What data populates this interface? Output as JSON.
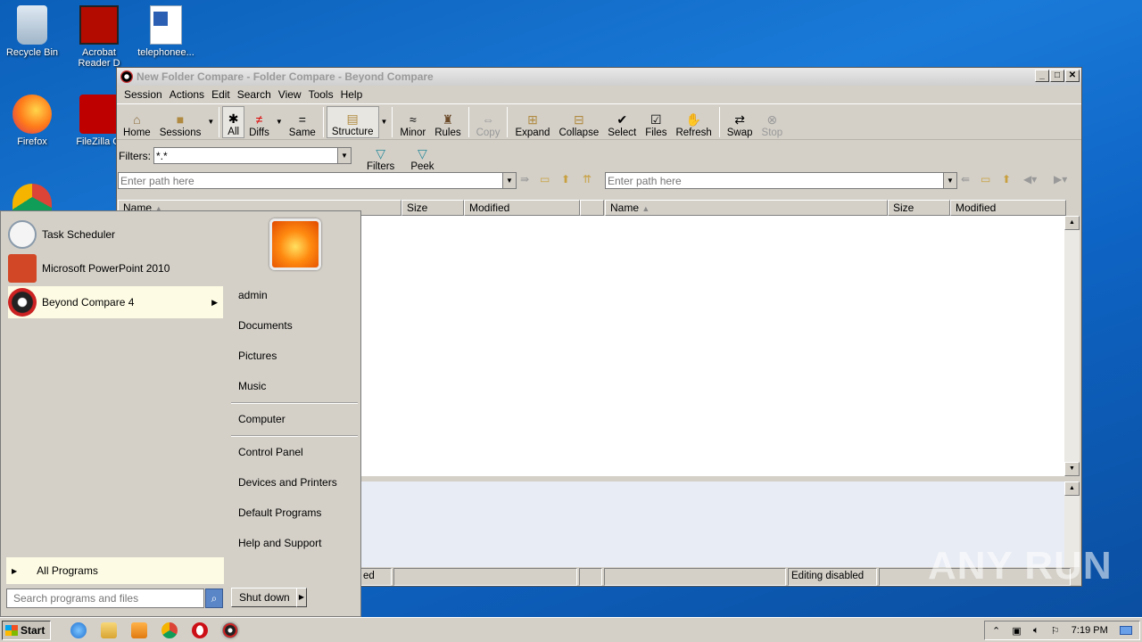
{
  "desktop": {
    "icons": [
      {
        "label": "Recycle Bin"
      },
      {
        "label": "Acrobat Reader D"
      },
      {
        "label": "telephonee..."
      },
      {
        "label": "Firefox"
      },
      {
        "label": "FileZilla Cl"
      }
    ]
  },
  "window": {
    "title": "New Folder Compare - Folder Compare - Beyond Compare",
    "menu": [
      "Session",
      "Actions",
      "Edit",
      "Search",
      "View",
      "Tools",
      "Help"
    ],
    "toolbar": {
      "home": "Home",
      "sessions": "Sessions",
      "all": "All",
      "diffs": "Diffs",
      "same": "Same",
      "structure": "Structure",
      "minor": "Minor",
      "rules": "Rules",
      "copy": "Copy",
      "expand": "Expand",
      "collapse": "Collapse",
      "select": "Select",
      "files": "Files",
      "refresh": "Refresh",
      "swap": "Swap",
      "stop": "Stop"
    },
    "filters": {
      "label": "Filters:",
      "value": "*.*",
      "filters_btn": "Filters",
      "peek_btn": "Peek"
    },
    "left_path": {
      "placeholder": "Enter path here"
    },
    "right_path": {
      "placeholder": "Enter path here"
    },
    "left_columns": [
      "Name",
      "Size",
      "Modified"
    ],
    "right_columns": [
      "Name",
      "Size",
      "Modified"
    ],
    "status": {
      "left_partial": "ed",
      "right": "Editing disabled"
    }
  },
  "start_menu": {
    "programs": [
      {
        "label": "Task Scheduler"
      },
      {
        "label": "Microsoft PowerPoint 2010"
      },
      {
        "label": "Beyond Compare 4"
      }
    ],
    "all_programs": "All Programs",
    "search_placeholder": "Search programs and files",
    "places": [
      "admin",
      "Documents",
      "Pictures",
      "Music",
      "Computer",
      "Control Panel",
      "Devices and Printers",
      "Default Programs",
      "Help and Support"
    ],
    "shutdown": "Shut down"
  },
  "taskbar": {
    "start": "Start",
    "clock": "7:19 PM"
  },
  "watermark": "ANY RUN"
}
